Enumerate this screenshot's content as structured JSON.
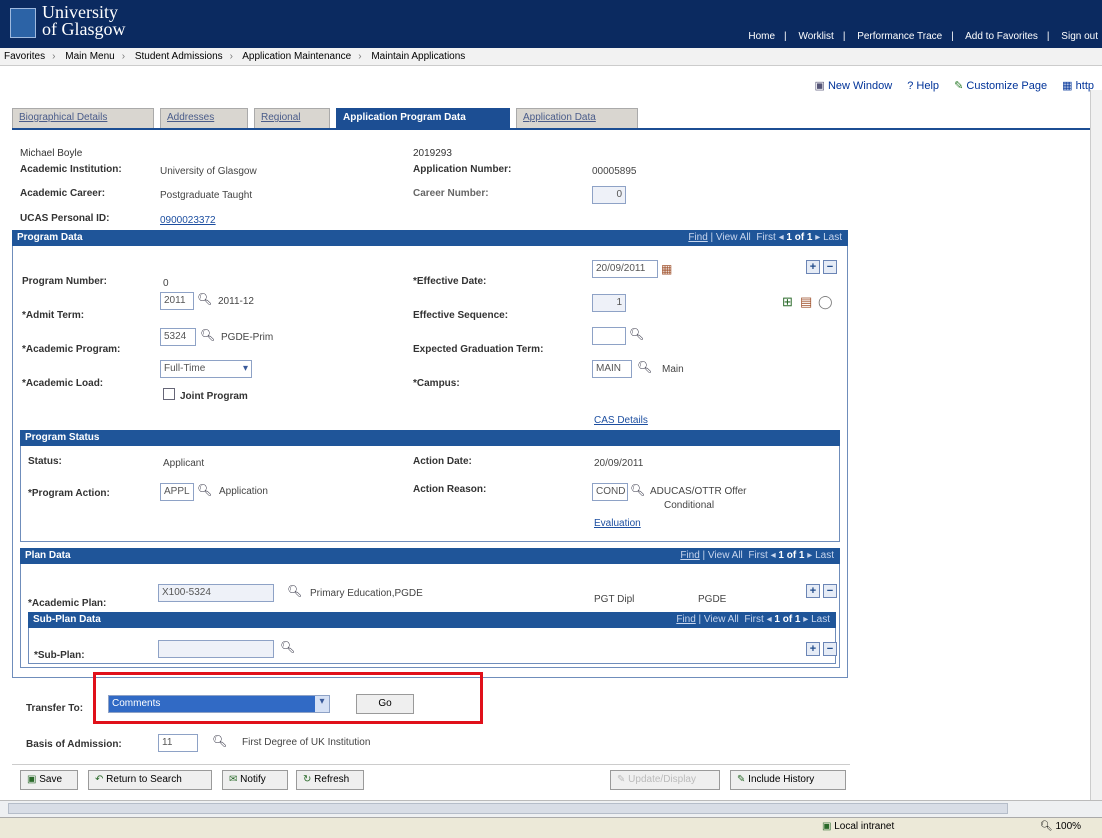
{
  "banner": {
    "logo_line1": "University",
    "logo_line2": "of Glasgow",
    "links": [
      "Home",
      "Worklist",
      "Performance Trace",
      "Add to Favorites",
      "Sign out"
    ]
  },
  "breadcrumb": [
    "Favorites",
    "Main Menu",
    "Student Admissions",
    "Application Maintenance",
    "Maintain Applications"
  ],
  "utility": {
    "new_window": "New Window",
    "help": "Help",
    "customize": "Customize Page",
    "http": "http"
  },
  "tabs": [
    "Biographical Details",
    "Addresses",
    "Regional",
    "Application Program Data",
    "Application Data"
  ],
  "header": {
    "name": "Michael Boyle",
    "id": "2019293",
    "inst_label": "Academic Institution:",
    "inst_value": "University of Glasgow",
    "appnum_label": "Application Number:",
    "appnum_value": "00005895",
    "career_label": "Academic Career:",
    "career_value": "Postgraduate Taught",
    "careernum_label": "Career Number:",
    "careernum_value": "0",
    "ucas_label": "UCAS Personal ID:",
    "ucas_value": "0900023372"
  },
  "program": {
    "title": "Program Data",
    "nav_find": "Find",
    "nav_viewall": "View All",
    "nav_first": "First",
    "nav_count": "1 of 1",
    "nav_last": "Last",
    "prognum_label": "Program Number:",
    "prognum_value": "0",
    "effdate_label": "*Effective Date:",
    "effdate_value": "20/09/2011",
    "admit_label": "*Admit Term:",
    "admit_value": "2011",
    "admit_desc": "2011-12",
    "effseq_label": "Effective Sequence:",
    "effseq_value": "1",
    "acprog_label": "*Academic Program:",
    "acprog_value": "5324",
    "acprog_desc": "PGDE-Prim",
    "expgrad_label": "Expected Graduation Term:",
    "expgrad_value": "",
    "acload_label": "*Academic Load:",
    "acload_value": "Full-Time",
    "campus_label": "*Campus:",
    "campus_value": "MAIN",
    "campus_desc": "Main",
    "joint_label": "Joint Program",
    "cas_link": "CAS Details"
  },
  "status": {
    "title": "Program Status",
    "status_label": "Status:",
    "status_value": "Applicant",
    "actdate_label": "Action Date:",
    "actdate_value": "20/09/2011",
    "progact_label": "*Program Action:",
    "progact_value": "APPL",
    "progact_desc": "Application",
    "reason_label": "Action Reason:",
    "reason_value": "COND",
    "reason_desc1": "ADUCAS/OTTR Offer",
    "reason_desc2": "Conditional",
    "eval_link": "Evaluation"
  },
  "plan": {
    "title": "Plan Data",
    "nav_find": "Find",
    "nav_viewall": "View All",
    "nav_first": "First",
    "nav_count": "1 of 1",
    "nav_last": "Last",
    "acplan_label": "*Academic Plan:",
    "acplan_value": "X100-5324",
    "acplan_desc": "Primary Education,PGDE",
    "plan_extra1": "PGT Dipl",
    "plan_extra2": "PGDE"
  },
  "subplan": {
    "title": "Sub-Plan Data",
    "nav_find": "Find",
    "nav_viewall": "View All",
    "nav_first": "First",
    "nav_count": "1 of 1",
    "nav_last": "Last",
    "label": "*Sub-Plan:",
    "value": ""
  },
  "transfer": {
    "label": "Transfer To:",
    "value": "Comments",
    "go": "Go"
  },
  "basis": {
    "label": "Basis of Admission:",
    "value": "11",
    "desc": "First Degree of UK Institution"
  },
  "toolbar": {
    "save": "Save",
    "return": "Return to Search",
    "notify": "Notify",
    "refresh": "Refresh",
    "update_display": "Update/Display",
    "include_history": "Include History"
  },
  "statusbar": {
    "zone": "Local intranet",
    "zoom": "100%"
  }
}
